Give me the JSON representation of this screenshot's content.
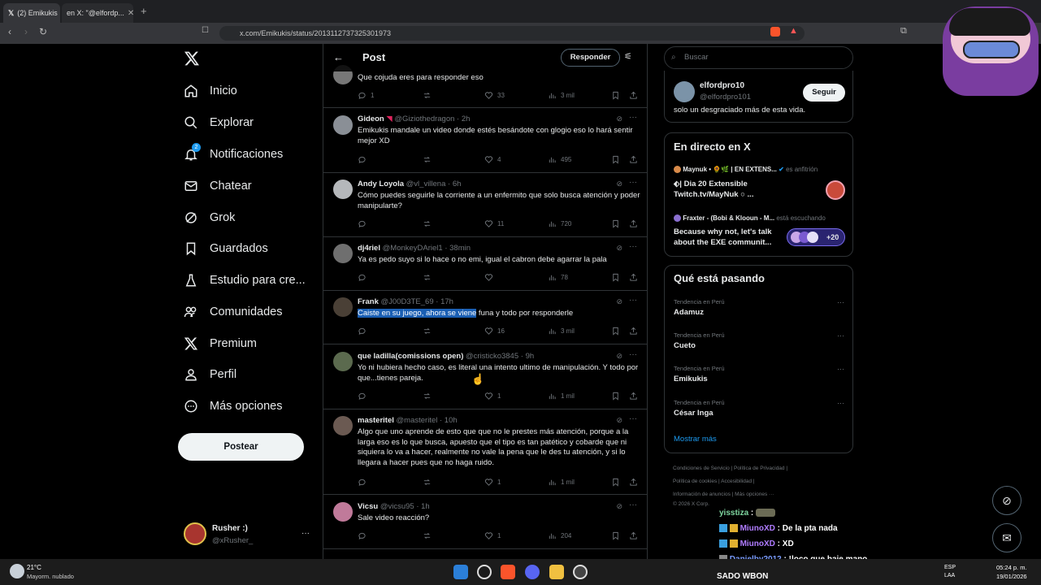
{
  "browser": {
    "tab1_label": "(2) Emikukis",
    "tab2_label": "en X: \"@elfordp...",
    "new_tab": "+",
    "url": "x.com/Emikukis/status/2013112737325301973"
  },
  "sidebar": {
    "items": [
      {
        "label": "Inicio",
        "icon": "home-icon"
      },
      {
        "label": "Explorar",
        "icon": "search-icon"
      },
      {
        "label": "Notificaciones",
        "icon": "bell-icon",
        "badge": "2"
      },
      {
        "label": "Chatear",
        "icon": "mail-icon"
      },
      {
        "label": "Grok",
        "icon": "grok-icon"
      },
      {
        "label": "Guardados",
        "icon": "bookmark-icon"
      },
      {
        "label": "Estudio para cre...",
        "icon": "flask-icon"
      },
      {
        "label": "Comunidades",
        "icon": "people-icon"
      },
      {
        "label": "Premium",
        "icon": "x-icon"
      },
      {
        "label": "Perfil",
        "icon": "person-icon"
      },
      {
        "label": "Más opciones",
        "icon": "more-icon"
      }
    ],
    "post_button": "Postear",
    "account": {
      "name": "Rusher :)",
      "handle": "@xRusher_",
      "more": "···"
    }
  },
  "header": {
    "title": "Post",
    "reply_button": "Responder"
  },
  "replies": [
    {
      "name": "",
      "handle": "",
      "time": "",
      "text": "Que cojuda eres para responder eso",
      "replies": "1",
      "likes": "33",
      "views": "3 mil"
    },
    {
      "name": "Gideon",
      "handle": "@Giziothedragon",
      "time": "· 2h",
      "text": "Emikukis mandale un video donde estés besándote con glogio eso lo hará sentir mejor XD",
      "replies": "",
      "likes": "4",
      "views": "495"
    },
    {
      "name": "Andy Loyola",
      "handle": "@vl_villena",
      "time": "· 6h",
      "text": "Cómo puedes seguirle la corriente a un enfermito que solo busca atención y poder manipularte?",
      "replies": "",
      "likes": "11",
      "views": "720"
    },
    {
      "name": "dj4riel",
      "handle": "@MonkeyDAriel1",
      "time": "· 38min",
      "text": "Ya es pedo suyo si lo hace o no emi, igual el cabron debe agarrar la pala",
      "replies": "",
      "likes": "",
      "views": "78"
    },
    {
      "name": "Frank",
      "handle": "@J00D3TE_69",
      "time": "· 17h",
      "text_highlight": "Caiste en su juego, ahora se viene",
      "text_rest": " funa y todo por responderle",
      "replies": "",
      "likes": "16",
      "views": "3 mil"
    },
    {
      "name": "que ladilla(comissions open)",
      "handle": "@cristicko3845",
      "time": "· 9h",
      "text": "Yo ni hubiera hecho caso, es literal una intento ultimo de manipulación. Y todo por que...tienes pareja.",
      "replies": "",
      "likes": "1",
      "views": "1 mil"
    },
    {
      "name": "masteritel",
      "handle": "@masteritel",
      "time": "· 10h",
      "text": "Algo que uno aprende de esto que que no le prestes más atención, porque a la larga eso es lo que busca, apuesto que el tipo es tan patético y cobarde que ni siquiera lo va a hacer, realmente no vale la pena que le des tu atención, y si lo llegara a hacer pues que no haga ruido.",
      "replies": "",
      "likes": "1",
      "views": "1 mil"
    },
    {
      "name": "Vicsu",
      "handle": "@vicsu95",
      "time": "· 1h",
      "text": "Sale video reacción?",
      "replies": "",
      "likes": "1",
      "views": "204"
    }
  ],
  "right": {
    "search_placeholder": "Buscar",
    "profile": {
      "name": "elfordpro10",
      "handle": "@elfordpro101",
      "bio": "solo un desgraciado más de esta vida.",
      "follow": "Seguir"
    },
    "live": {
      "title": "En directo en X",
      "item1_host": "Maynuk • 🌻🌿 | EN EXTENS...",
      "item1_role": "es anfitrión",
      "item1_text1": "⬖| Dia 20 Extensible",
      "item1_text2": "Twitch.tv/MayNuk ○ ...",
      "item2_host": "Fraxter - (Bobi & Klooun - M...",
      "item2_role": "está escuchando",
      "item2_text1": "Because why not, let's talk",
      "item2_text2": "about the EXE communit...",
      "item2_count": "+20"
    },
    "trends": {
      "title": "Qué está pasando",
      "items": [
        {
          "caption": "Tendencia en Perú",
          "name": "Adamuz"
        },
        {
          "caption": "Tendencia en Perú",
          "name": "Cueto"
        },
        {
          "caption": "Tendencia en Perú",
          "name": "Emikukis"
        },
        {
          "caption": "Tendencia en Perú",
          "name": "César Inga"
        }
      ],
      "show_more": "Mostrar más"
    },
    "footer": {
      "line1": "Condiciones de Servicio  |  Política de Privacidad  |",
      "line2": "Política de cookies  |  Accesibilidad  |",
      "line3": "Información de anuncios  |  Más opciones ···",
      "line4": "© 2026 X Corp."
    }
  },
  "stream_chat": [
    {
      "user": "yisstiza",
      "msg": "",
      "color": "#7fd6a0"
    },
    {
      "user": "MiunoXD",
      "msg": "De la pta nada",
      "color": "#b07cff"
    },
    {
      "user": "MiunoXD",
      "msg": "XD",
      "color": "#b07cff"
    },
    {
      "user": "Danielby2012",
      "msg": "!loco que baje mano",
      "color": "#7a9cff"
    },
    {
      "user": "",
      "msg": "SADO WBON",
      "color": "#ffffff"
    }
  ],
  "taskbar": {
    "weather_temp": "21°C",
    "weather_desc": "Mayorm. nublado",
    "lang1": "ESP",
    "lang2": "LAA",
    "time": "05:24 p. m.",
    "date": "19/01/2026"
  },
  "colors": {
    "accent": "#1d9bf0",
    "border": "#2f3336",
    "muted": "#71767b"
  }
}
